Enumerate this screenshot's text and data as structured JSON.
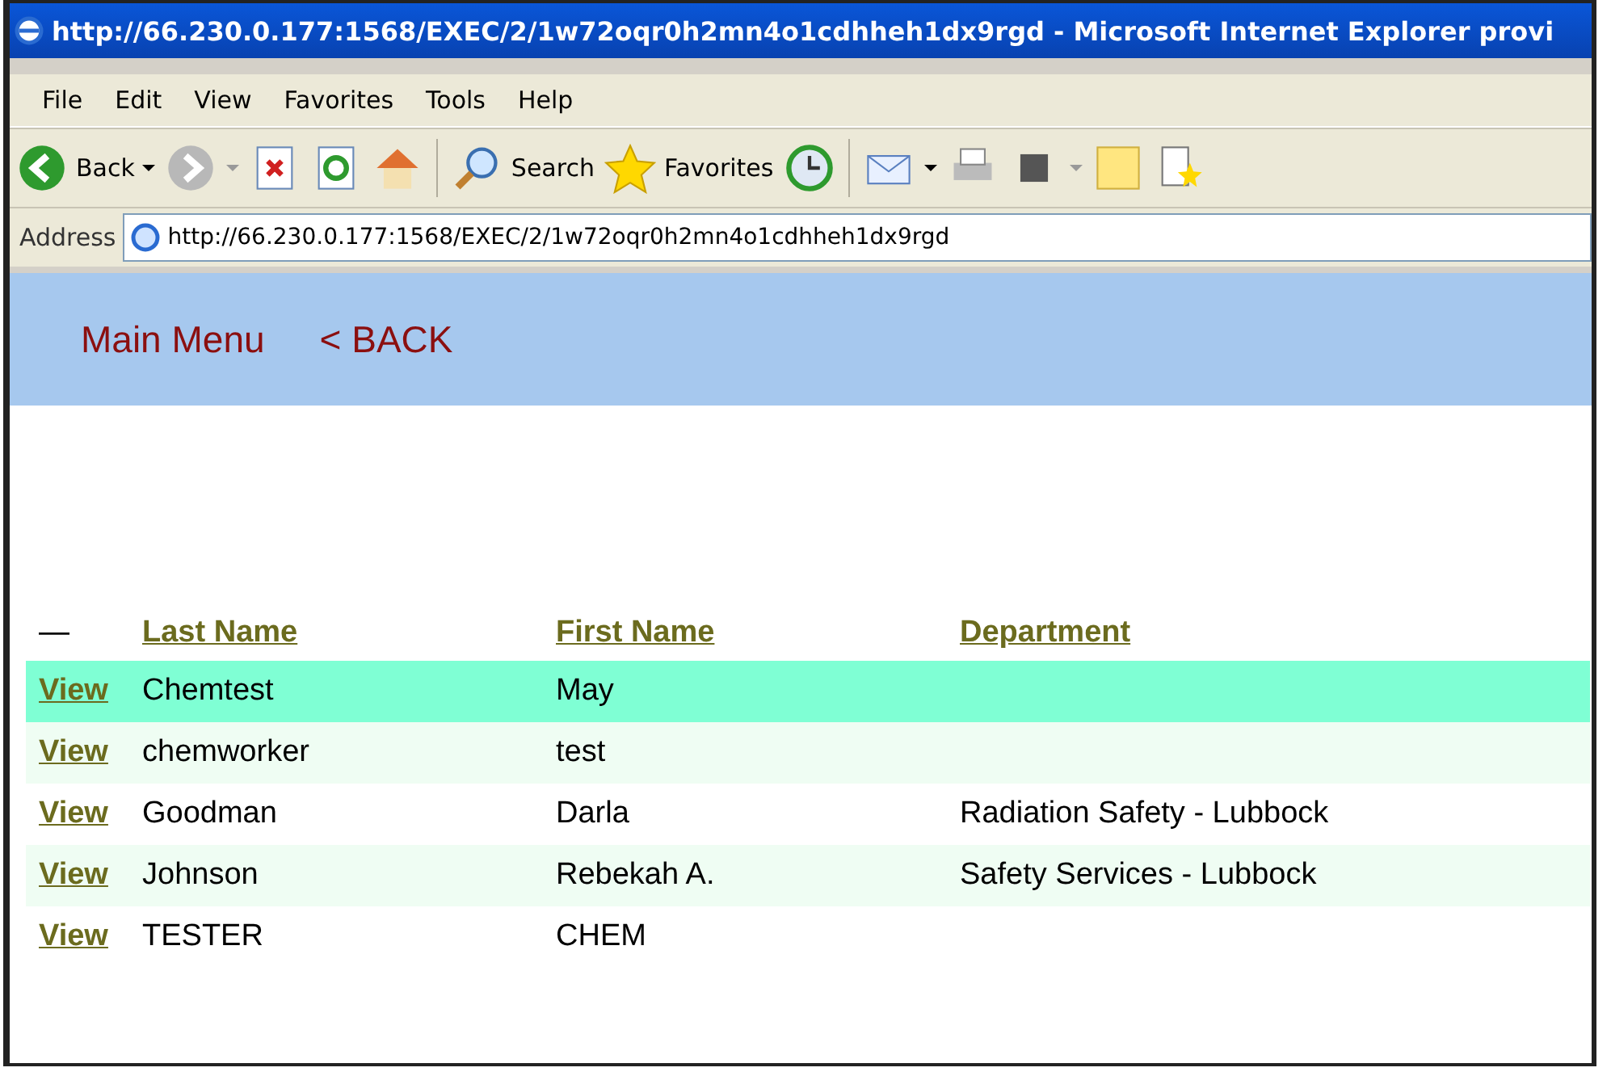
{
  "window": {
    "title": "http://66.230.0.177:1568/EXEC/2/1w72oqr0h2mn4o1cdhheh1dx9rgd - Microsoft Internet Explorer provi"
  },
  "menu": [
    "File",
    "Edit",
    "View",
    "Favorites",
    "Tools",
    "Help"
  ],
  "toolbar": {
    "back": "Back",
    "search": "Search",
    "favorites": "Favorites"
  },
  "address": {
    "label": "Address",
    "value": "http://66.230.0.177:1568/EXEC/2/1w72oqr0h2mn4o1cdhheh1dx9rgd"
  },
  "nav": [
    "Main Menu",
    "< BACK"
  ],
  "table": {
    "columns": [
      "—",
      "Last Name",
      "First Name",
      "Department"
    ],
    "rows": [
      {
        "link": "View",
        "last": "Chemtest",
        "first": "May",
        "dept": "",
        "selected": true
      },
      {
        "link": "View",
        "last": "chemworker",
        "first": "test",
        "dept": "",
        "selected": false
      },
      {
        "link": "View",
        "last": "Goodman",
        "first": "Darla",
        "dept": "Radiation Safety - Lubbock",
        "selected": false
      },
      {
        "link": "View",
        "last": "Johnson",
        "first": "Rebekah A.",
        "dept": "Safety Services - Lubbock",
        "selected": false
      },
      {
        "link": "View",
        "last": "TESTER",
        "first": "CHEM",
        "dept": "",
        "selected": false
      }
    ]
  }
}
